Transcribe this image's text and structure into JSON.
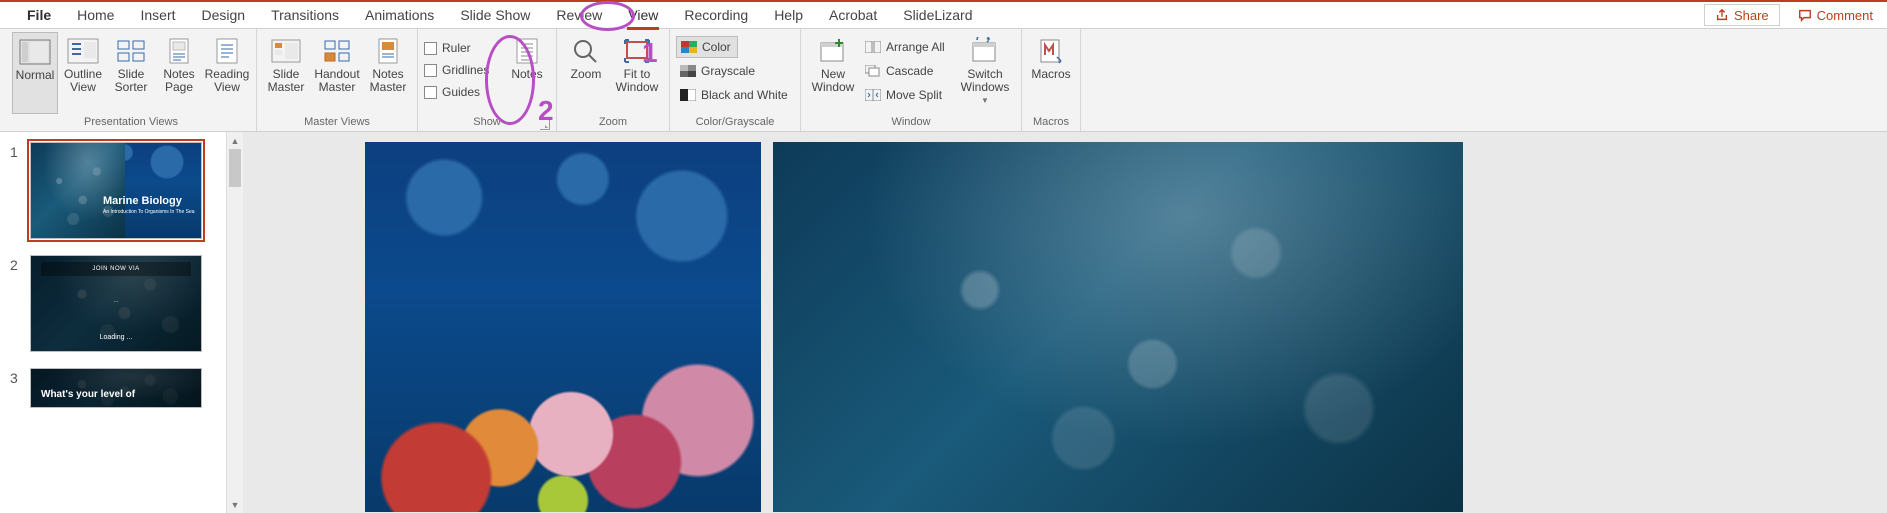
{
  "tabs": {
    "file": "File",
    "items": [
      "Home",
      "Insert",
      "Design",
      "Transitions",
      "Animations",
      "Slide Show",
      "Review",
      "View",
      "Recording",
      "Help",
      "Acrobat",
      "SlideLizard"
    ],
    "active": "View",
    "share": "Share",
    "comment": "Comment"
  },
  "annotations": {
    "one": "1",
    "two": "2"
  },
  "ribbon": {
    "presentation_views": {
      "label": "Presentation Views",
      "normal": "Normal",
      "outline": "Outline\nView",
      "sorter": "Slide\nSorter",
      "notes_page": "Notes\nPage",
      "reading": "Reading\nView"
    },
    "master_views": {
      "label": "Master Views",
      "slide_master": "Slide\nMaster",
      "handout_master": "Handout\nMaster",
      "notes_master": "Notes\nMaster"
    },
    "show": {
      "label": "Show",
      "ruler": "Ruler",
      "gridlines": "Gridlines",
      "guides": "Guides",
      "notes": "Notes"
    },
    "zoom": {
      "label": "Zoom",
      "zoom": "Zoom",
      "fit": "Fit to\nWindow"
    },
    "color": {
      "label": "Color/Grayscale",
      "color": "Color",
      "grayscale": "Grayscale",
      "bw": "Black and White"
    },
    "window": {
      "label": "Window",
      "new": "New\nWindow",
      "arrange": "Arrange All",
      "cascade": "Cascade",
      "move_split": "Move Split",
      "switch": "Switch\nWindows"
    },
    "macros": {
      "label": "Macros",
      "macros": "Macros"
    }
  },
  "thumbs": {
    "n1": "1",
    "n2": "2",
    "n3": "3",
    "s1_title": "Marine Biology",
    "s1_sub": "An Introduction To Organisms In The Sea",
    "s2_bar": "JOIN NOW VIA",
    "s2_center": "···",
    "s2_load": "Loading ...",
    "s3_text": "What's your level of"
  }
}
